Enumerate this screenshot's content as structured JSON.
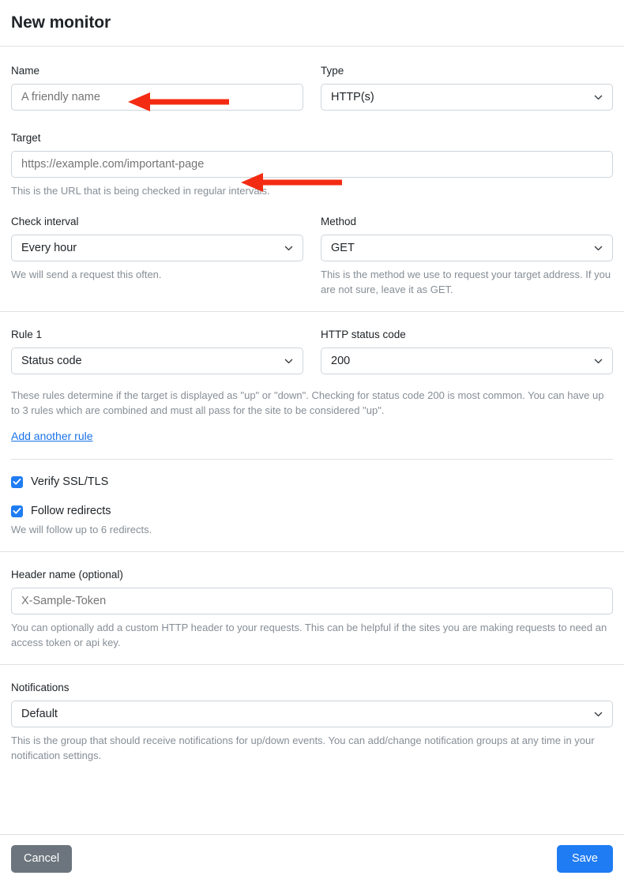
{
  "header": {
    "title": "New monitor"
  },
  "fields": {
    "name": {
      "label": "Name",
      "placeholder": "A friendly name",
      "value": ""
    },
    "type": {
      "label": "Type",
      "value": "HTTP(s)",
      "options": [
        "HTTP(s)"
      ]
    },
    "target": {
      "label": "Target",
      "placeholder": "https://example.com/important-page",
      "value": "",
      "help": "This is the URL that is being checked in regular intervals."
    },
    "check_interval": {
      "label": "Check interval",
      "value": "Every hour",
      "options": [
        "Every hour"
      ],
      "help": "We will send a request this often."
    },
    "method": {
      "label": "Method",
      "value": "GET",
      "options": [
        "GET"
      ],
      "help": "This is the method we use to request your target address. If you are not sure, leave it as GET."
    },
    "rule_1": {
      "label": "Rule 1",
      "value": "Status code",
      "options": [
        "Status code"
      ]
    },
    "http_status_code": {
      "label": "HTTP status code",
      "value": "200",
      "options": [
        "200"
      ]
    },
    "rules_help": "These rules determine if the target is displayed as \"up\" or \"down\". Checking for status code 200 is most common. You can have up to 3 rules which are combined and must all pass for the site to be considered \"up\".",
    "add_rule_link": "Add another rule",
    "verify_ssl": {
      "label": "Verify SSL/TLS",
      "checked": true
    },
    "follow_redirects": {
      "label": "Follow redirects",
      "checked": true,
      "help": "We will follow up to 6 redirects."
    },
    "header_name": {
      "label": "Header name (optional)",
      "placeholder": "X-Sample-Token",
      "value": "",
      "help": "You can optionally add a custom HTTP header to your requests. This can be helpful if the sites you are making requests to need an access token or api key."
    },
    "notifications": {
      "label": "Notifications",
      "value": "Default",
      "options": [
        "Default"
      ],
      "help": "This is the group that should receive notifications for up/down events. You can add/change notification groups at any time in your notification settings."
    }
  },
  "footer": {
    "cancel_label": "Cancel",
    "save_label": "Save"
  },
  "annotations": [
    {
      "name": "arrow-to-name-field",
      "direction": "left"
    },
    {
      "name": "arrow-to-target-field",
      "direction": "left"
    }
  ],
  "colors": {
    "accent_blue": "#1f7cf2",
    "link_blue": "#1a73e8",
    "cancel_gray": "#6c757d",
    "annotation_red": "#f42b13",
    "border": "#ced4da",
    "divider": "#dee2e6",
    "muted_text": "#868e96"
  },
  "icons": {
    "chevron_down": "chevron-down-icon",
    "checkmark": "checkmark-icon",
    "arrow_left": "arrow-left-icon"
  }
}
